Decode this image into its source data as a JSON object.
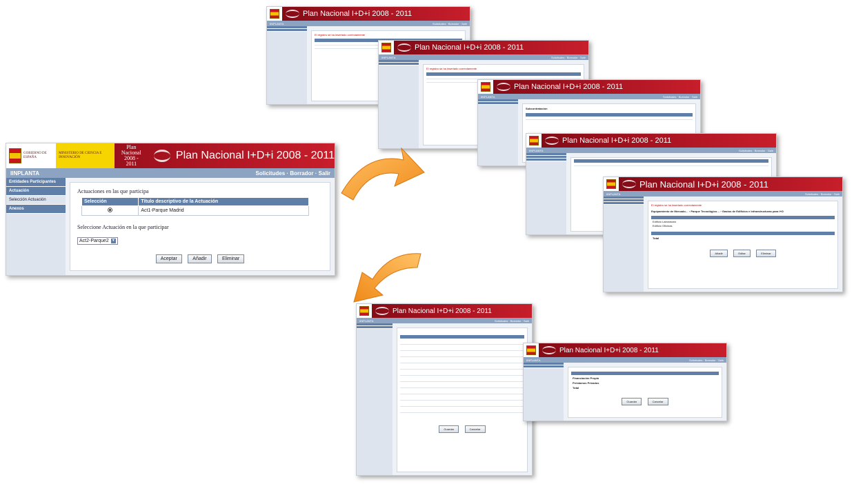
{
  "app": {
    "banner_title": "Plan Nacional I+D+i 2008 - 2011",
    "gov_line1": "GOBIERNO DE ESPAÑA",
    "gov_line2": "MINISTERIO DE CIENCIA E INNOVACIÓN",
    "pn_tag_top": "Plan Nacional",
    "pn_tag_bottom": "2008 - 2011",
    "app_name": "IINPLANTA",
    "nav_links": "Solicitudes · Borrador · Salir"
  },
  "sidebar": {
    "items": [
      {
        "label": "Entidades Participantes"
      },
      {
        "label": "Actuación"
      },
      {
        "label": "Selección Actuación"
      },
      {
        "label": "Anexos"
      }
    ]
  },
  "main": {
    "section_title": "Actuaciones en las que participa",
    "table": {
      "headers": [
        "Selección",
        "Título descriptivo de la Actuación"
      ],
      "rows": [
        {
          "title": "Act1-Parque Madrid",
          "selected": true
        }
      ]
    },
    "select_label": "Seleccione Actuación en la que participar",
    "select_value": "Act2-Parque2",
    "buttons": {
      "accept": "Aceptar",
      "add": "Añadir",
      "delete": "Eliminar"
    }
  },
  "thumbs": {
    "success_msg": "El registro se ha insertado correctamente",
    "t3_title": "Subcontratación",
    "t5_title": "Equipamiento de Mercado… › Parque Tecnológico… › Gastos de Edificios e Infraestructuras para I+D",
    "t5_rows": [
      "Edificio Laboratorio",
      "Edificio Oficinas"
    ],
    "t5_total_label": "Total",
    "t5_buttons": [
      "Añadir",
      "Editar",
      "Eliminar"
    ],
    "t7_rows": [
      "Financiación Propia",
      "Préstamos Privados",
      "Total"
    ],
    "t7_buttons": [
      "Guardar",
      "Cancelar"
    ]
  }
}
